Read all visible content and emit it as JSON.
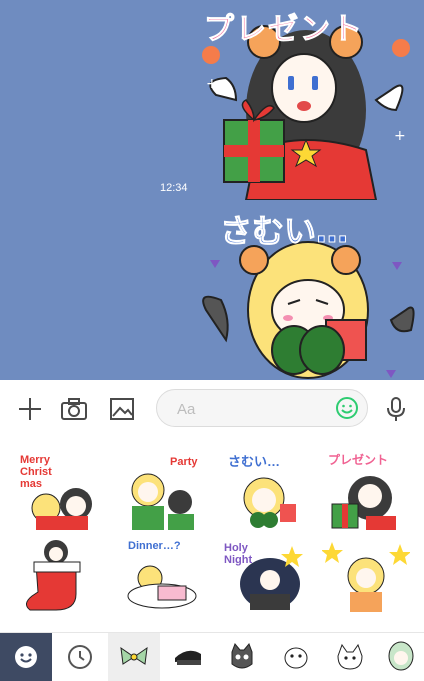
{
  "chat": {
    "timestamp": "12:34",
    "sticker_1_caption": "プレゼント",
    "sticker_2_caption": "さむい…"
  },
  "input_bar": {
    "placeholder": "Aa",
    "icons": [
      "plus-icon",
      "camera-icon",
      "image-icon",
      "emoji-icon",
      "microphone-icon"
    ]
  },
  "sticker_grid": {
    "items": [
      {
        "caption": "Merry\nChrist\nmas"
      },
      {
        "caption": "Party"
      },
      {
        "caption": "さむい…"
      },
      {
        "caption": "プレゼント"
      },
      {
        "caption": ""
      },
      {
        "caption": "Dinner…?"
      },
      {
        "caption": "Holy\nNight"
      },
      {
        "caption": ""
      }
    ]
  },
  "tab_bar": {
    "tabs": [
      "emoji",
      "recent",
      "sticker-pack-1",
      "sticker-pack-2",
      "sticker-pack-3",
      "sticker-pack-4",
      "sticker-pack-5",
      "sticker-pack-6"
    ]
  },
  "colors": {
    "chat_background": "#6f8cc0",
    "active_tab": "#3e4a63",
    "pink_caption": "#f06292",
    "blue_caption": "#3f6fd1"
  }
}
